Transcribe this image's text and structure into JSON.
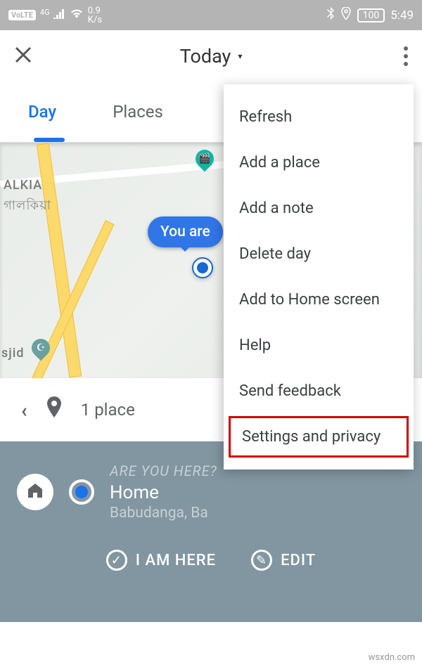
{
  "status": {
    "volte": "VoLTE",
    "sig_gen": "4G",
    "speed_top": "0.9",
    "speed_bot": "K/s",
    "battery": "100",
    "time": "5:49"
  },
  "header": {
    "title": "Today"
  },
  "tabs": {
    "day": "Day",
    "places": "Places"
  },
  "map": {
    "label1": "ALKIA",
    "label1_sub": "গালকিয়া",
    "label2": "sjid",
    "you_are": "You are"
  },
  "place_bar": {
    "count_text": "1 place"
  },
  "panel": {
    "question": "ARE YOU HERE?",
    "home": "Home",
    "addr": "Babudanga, Ba",
    "btn1": "I AM HERE",
    "btn2": "EDIT"
  },
  "menu": {
    "items": [
      "Refresh",
      "Add a place",
      "Add a note",
      "Delete day",
      "Add to Home screen",
      "Help",
      "Send feedback",
      "Settings and privacy"
    ]
  },
  "watermark": "wsxdn.com"
}
